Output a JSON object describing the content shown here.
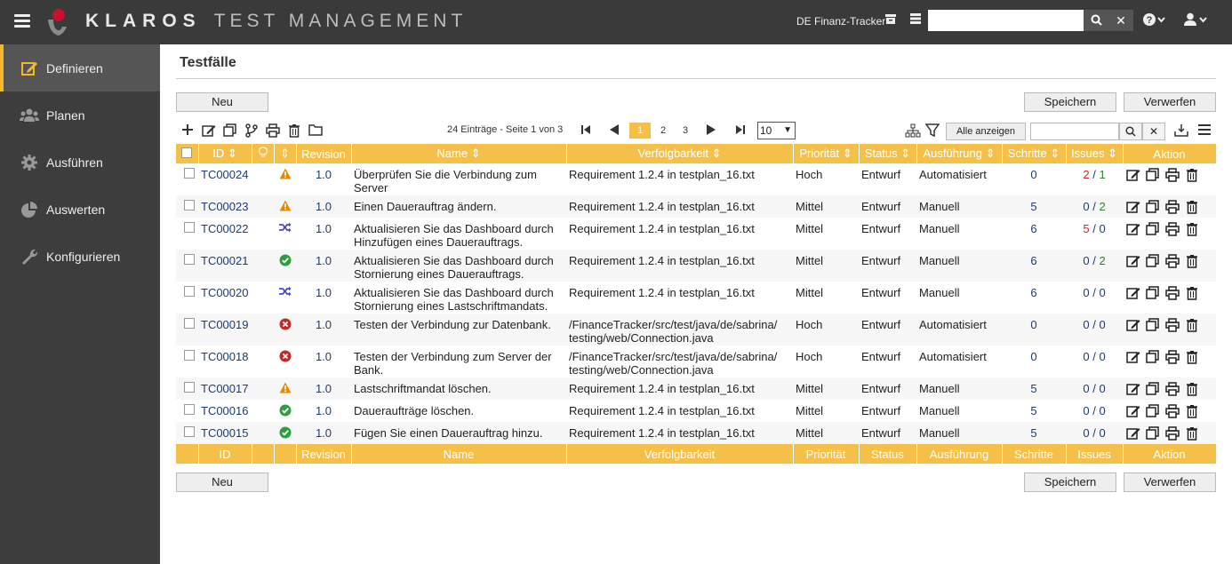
{
  "header": {
    "brand_main": "KLAROS",
    "brand_sub": "TEST MANAGEMENT",
    "project": "DE Finanz-Tracker",
    "search_value": ""
  },
  "sidebar": {
    "items": [
      {
        "label": "Definieren",
        "icon": "edit-icon",
        "active": true
      },
      {
        "label": "Planen",
        "icon": "users-icon",
        "active": false
      },
      {
        "label": "Ausführen",
        "icon": "gear-icon",
        "active": false
      },
      {
        "label": "Auswerten",
        "icon": "pie-chart-icon",
        "active": false
      },
      {
        "label": "Konfigurieren",
        "icon": "wrench-icon",
        "active": false
      }
    ]
  },
  "main": {
    "title": "Testfälle",
    "new_label": "Neu",
    "save_label": "Speichern",
    "discard_label": "Verwerfen",
    "pager_info": "24 Einträge - Seite 1 von 3",
    "pages": [
      "1",
      "2",
      "3"
    ],
    "per_page": "10",
    "show_all_label": "Alle anzeigen",
    "filter_value": ""
  },
  "table": {
    "headers": [
      "ID",
      "Revision",
      "Name",
      "Verfolgbarkeit",
      "Priorität",
      "Status",
      "Ausführung",
      "Schritte",
      "Issues",
      "Aktion"
    ],
    "rows": [
      {
        "id": "TC00024",
        "status": "warning",
        "revision": "1.0",
        "name": "Überprüfen Sie die Verbindung zum Server",
        "trace": "Requirement 1.2.4 in testplan_16.txt",
        "priority": "Hoch",
        "state": "Entwurf",
        "execution": "Automatisiert",
        "steps": "0",
        "issues_open": "2",
        "issues_closed": "1",
        "issues_open_color": "red",
        "issues_closed_color": "green"
      },
      {
        "id": "TC00023",
        "status": "warning",
        "revision": "1.0",
        "name": "Einen Dauerauftrag ändern.",
        "trace": "Requirement 1.2.4 in testplan_16.txt",
        "priority": "Mittel",
        "state": "Entwurf",
        "execution": "Manuell",
        "steps": "5",
        "issues_open": "0",
        "issues_closed": "2",
        "issues_open_color": "navy",
        "issues_closed_color": "green"
      },
      {
        "id": "TC00022",
        "status": "mixed",
        "revision": "1.0",
        "name": "Aktualisieren Sie das Dashboard durch Hinzufügen eines Dauerauftrags.",
        "trace": "Requirement 1.2.4 in testplan_16.txt",
        "priority": "Mittel",
        "state": "Entwurf",
        "execution": "Manuell",
        "steps": "6",
        "issues_open": "5",
        "issues_closed": "0",
        "issues_open_color": "red",
        "issues_closed_color": "navy"
      },
      {
        "id": "TC00021",
        "status": "passed",
        "revision": "1.0",
        "name": "Aktualisieren Sie das Dashboard durch Stornierung eines Dauerauftrags.",
        "trace": "Requirement 1.2.4 in testplan_16.txt",
        "priority": "Mittel",
        "state": "Entwurf",
        "execution": "Manuell",
        "steps": "6",
        "issues_open": "0",
        "issues_closed": "2",
        "issues_open_color": "navy",
        "issues_closed_color": "green"
      },
      {
        "id": "TC00020",
        "status": "mixed",
        "revision": "1.0",
        "name": "Aktualisieren Sie das Dashboard durch Stornierung eines Lastschriftmandats.",
        "trace": "Requirement 1.2.4 in testplan_16.txt",
        "priority": "Mittel",
        "state": "Entwurf",
        "execution": "Manuell",
        "steps": "6",
        "issues_open": "0",
        "issues_closed": "0",
        "issues_open_color": "navy",
        "issues_closed_color": "navy"
      },
      {
        "id": "TC00019",
        "status": "failed",
        "revision": "1.0",
        "name": "Testen der Verbindung zur Datenbank.",
        "trace": "/FinanceTracker/src/test/java/de/sabrina/ testing/web/Connection.java",
        "priority": "Hoch",
        "state": "Entwurf",
        "execution": "Automatisiert",
        "steps": "0",
        "issues_open": "0",
        "issues_closed": "0",
        "issues_open_color": "navy",
        "issues_closed_color": "navy"
      },
      {
        "id": "TC00018",
        "status": "failed",
        "revision": "1.0",
        "name": "Testen der Verbindung zum Server der Bank.",
        "trace": "/FinanceTracker/src/test/java/de/sabrina/ testing/web/Connection.java",
        "priority": "Hoch",
        "state": "Entwurf",
        "execution": "Automatisiert",
        "steps": "0",
        "issues_open": "0",
        "issues_closed": "0",
        "issues_open_color": "navy",
        "issues_closed_color": "navy"
      },
      {
        "id": "TC00017",
        "status": "warning",
        "revision": "1.0",
        "name": "Lastschriftmandat löschen.",
        "trace": "Requirement 1.2.4 in testplan_16.txt",
        "priority": "Mittel",
        "state": "Entwurf",
        "execution": "Manuell",
        "steps": "5",
        "issues_open": "0",
        "issues_closed": "0",
        "issues_open_color": "navy",
        "issues_closed_color": "navy"
      },
      {
        "id": "TC00016",
        "status": "passed",
        "revision": "1.0",
        "name": "Daueraufträge löschen.",
        "trace": "Requirement 1.2.4 in testplan_16.txt",
        "priority": "Mittel",
        "state": "Entwurf",
        "execution": "Manuell",
        "steps": "5",
        "issues_open": "0",
        "issues_closed": "0",
        "issues_open_color": "navy",
        "issues_closed_color": "navy"
      },
      {
        "id": "TC00015",
        "status": "passed",
        "revision": "1.0",
        "name": "Fügen Sie einen Dauerauftrag hinzu.",
        "trace": "Requirement 1.2.4 in testplan_16.txt",
        "priority": "Mittel",
        "state": "Entwurf",
        "execution": "Manuell",
        "steps": "5",
        "issues_open": "0",
        "issues_closed": "0",
        "issues_open_color": "navy",
        "issues_closed_color": "navy"
      }
    ]
  },
  "colors": {
    "accent": "#f5c04a",
    "topbar": "#3a3a3a",
    "sidebar": "#3d3d3d",
    "warning": "#e68a00",
    "passed": "#2e9e3e",
    "failed": "#c62828",
    "mixed": "#4a4ac8"
  }
}
